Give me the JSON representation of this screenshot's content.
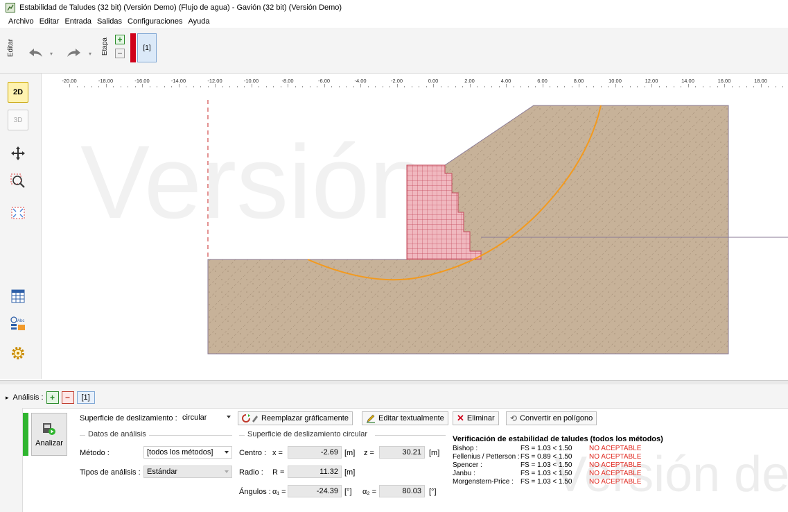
{
  "window": {
    "title": "Estabilidad de Taludes (32 bit) (Versión Demo) (Flujo de agua) - Gavión (32 bit) (Versión Demo)"
  },
  "menu": [
    {
      "label": "Archivo"
    },
    {
      "label": "Editar"
    },
    {
      "label": "Entrada"
    },
    {
      "label": "Salidas"
    },
    {
      "label": "Configuraciones"
    },
    {
      "label": "Ayuda"
    }
  ],
  "toolbar": {
    "edit_label": "Editar",
    "stage_label": "Etapa",
    "stage_tab": "[1]"
  },
  "ruler": {
    "labels": [
      "-20.00",
      "-18.00",
      "-16.00",
      "-14.00",
      "-12.00",
      "-10.00",
      "-8.00",
      "-6.00",
      "-4.00",
      "-2.00",
      "0.00",
      "2.00",
      "4.00",
      "6.00",
      "8.00",
      "10.00",
      "12.00",
      "14.00",
      "16.00",
      "18.00"
    ]
  },
  "sidebar": {
    "mode_2d": "2D",
    "mode_3d": "3D"
  },
  "watermark": {
    "canvas_text": "Versión dem",
    "panel_text": "Versión de"
  },
  "analysis": {
    "label": "Análisis :",
    "stage_tab": "[1]",
    "analyze_button": "Analizar",
    "surface_label": "Superficie de deslizamiento :",
    "surface_value": "circular",
    "btn_replace": "Reemplazar gráficamente",
    "btn_edit": "Editar textualmente",
    "btn_delete": "Eliminar",
    "btn_convert": "Convertir en polígono",
    "data_group": "Datos de análisis",
    "method_label": "Método :",
    "method_value": "[todos los métodos]",
    "type_label": "Tipos de análisis :",
    "type_value": "Estándar",
    "circle_group": "Superficie de deslizamiento circular",
    "center_label": "Centro :",
    "x_label": "x =",
    "x_value": "-2.69",
    "x_unit": "[m]",
    "z_label": "z =",
    "z_value": "30.21",
    "z_unit": "[m]",
    "radius_label": "Radio :",
    "r_label": "R =",
    "r_value": "11.32",
    "r_unit": "[m]",
    "angles_label": "Ángulos :",
    "a1_label": "α₁ =",
    "a1_value": "-24.39",
    "a1_unit": "[°]",
    "a2_label": "α₂ =",
    "a2_value": "80.03",
    "a2_unit": "[°]"
  },
  "results": {
    "title": "Verificación de estabilidad de taludes (todos los métodos)",
    "rows": [
      {
        "method": "Bishop :",
        "fs": "FS = 1.03 < 1.50",
        "status": "NO ACEPTABLE"
      },
      {
        "method": "Fellenius / Petterson :",
        "fs": "FS = 0.89 < 1.50",
        "status": "NO ACEPTABLE"
      },
      {
        "method": "Spencer :",
        "fs": "FS = 1.03 < 1.50",
        "status": "NO ACEPTABLE"
      },
      {
        "method": "Janbu :",
        "fs": "FS = 1.03 < 1.50",
        "status": "NO ACEPTABLE"
      },
      {
        "method": "Morgenstern-Price :",
        "fs": "FS = 1.03 < 1.50",
        "status": "NO ACEPTABLE"
      }
    ]
  },
  "colors": {
    "soil": "#c7b299",
    "gabion": "#f0b8bf",
    "gabion_lines": "#c44a5b",
    "slip_circle": "#f39a1e",
    "fail_text": "#e0281f",
    "stage_red": "#d0021b",
    "analyze_green": "#2fb52f"
  }
}
